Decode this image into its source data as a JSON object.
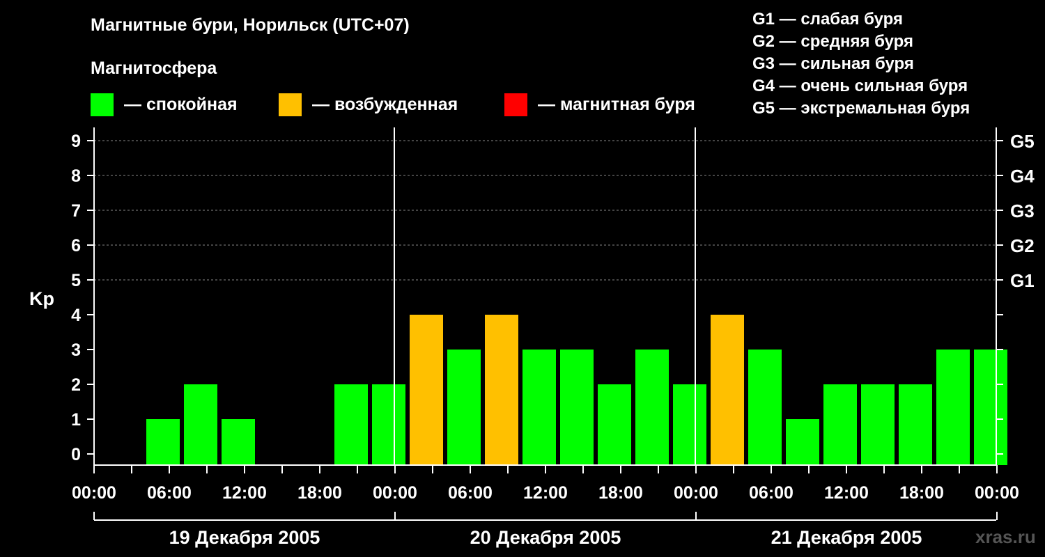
{
  "chart_data": {
    "type": "bar",
    "title": "Магнитные бури, Норильск (UTC+07)",
    "ylabel": "Kp",
    "ylim": [
      0,
      9
    ],
    "y_ticks": [
      "0",
      "1",
      "2",
      "3",
      "4",
      "5",
      "6",
      "7",
      "8",
      "9"
    ],
    "g_scale": [
      {
        "kp": 5,
        "label": "G1"
      },
      {
        "kp": 6,
        "label": "G2"
      },
      {
        "kp": 7,
        "label": "G3"
      },
      {
        "kp": 8,
        "label": "G4"
      },
      {
        "kp": 9,
        "label": "G5"
      }
    ],
    "x_ticks": [
      "00:00",
      "06:00",
      "12:00",
      "18:00",
      "00:00",
      "06:00",
      "12:00",
      "18:00",
      "00:00",
      "06:00",
      "12:00",
      "18:00",
      "00:00"
    ],
    "days": [
      "19 Декабря 2005",
      "20 Декабря 2005",
      "21 Декабря 2005"
    ],
    "interval_hours": 3,
    "values": [
      0,
      1,
      2,
      1,
      0,
      0,
      2,
      2,
      4,
      3,
      4,
      3,
      3,
      2,
      3,
      2,
      4,
      3,
      1,
      2,
      2,
      2,
      3,
      3
    ],
    "levels": [
      "q",
      "q",
      "q",
      "q",
      "q",
      "q",
      "q",
      "q",
      "e",
      "q",
      "e",
      "q",
      "q",
      "q",
      "q",
      "q",
      "e",
      "q",
      "q",
      "q",
      "q",
      "q",
      "q",
      "q"
    ],
    "colors": {
      "quiet": "#00ff00",
      "excited": "#ffc000",
      "storm": "#ff0000",
      "grid": "#888888"
    },
    "grid": true
  },
  "legend": {
    "heading": "Магнитосфера",
    "items": [
      {
        "label": "— спокойная",
        "color": "#00ff00"
      },
      {
        "label": "— возбужденная",
        "color": "#ffc000"
      },
      {
        "label": "— магнитная буря",
        "color": "#ff0000"
      }
    ]
  },
  "storm_scale": [
    "G1 — слабая буря",
    "G2 — средняя буря",
    "G3 — сильная буря",
    "G4 — очень сильная буря",
    "G5 — экстремальная буря"
  ],
  "watermark": "xras.ru"
}
